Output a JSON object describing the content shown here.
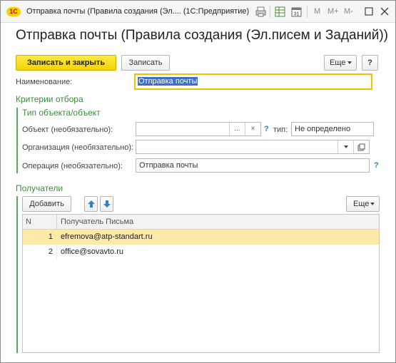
{
  "window": {
    "app_logo": "1С",
    "title": "Отправка почты (Правила создания (Эл.... (1С:Предприятие)",
    "toolbar_m": "M",
    "toolbar_m_plus": "M+",
    "toolbar_m_minus": "M-"
  },
  "page": {
    "title": "Отправка почты (Правила создания (Эл.писем и Заданий))"
  },
  "toolbar": {
    "save_close_label": "Записать и закрыть",
    "save_label": "Записать",
    "more_label": "Еще",
    "help_label": "?"
  },
  "form": {
    "name_label": "Наименование:",
    "name_value": "Отправка почты",
    "criteria_title": "Критерии отбора",
    "object_type_title": "Тип объекта/объект",
    "object_label": "Объект (необязательно):",
    "object_value": "",
    "object_select_label": "...",
    "object_clear_label": "×",
    "help_mark": "?",
    "type_label": "тип:",
    "type_value": "Не определено",
    "org_label": "Организация (необязательно):",
    "org_value": "",
    "operation_label": "Операция (необязательно):",
    "operation_value": "Отправка почты"
  },
  "recipients": {
    "title": "Получатели",
    "add_label": "Добавить",
    "more_label": "Еще",
    "columns": [
      "N",
      "Получатель Письма"
    ],
    "rows": [
      {
        "n": "1",
        "email": "efremova@atp-standart.ru",
        "selected": true
      },
      {
        "n": "2",
        "email": "office@sovavto.ru",
        "selected": false
      }
    ]
  },
  "colors": {
    "primary_button": "#f4d400",
    "group_title": "#3d8b3d",
    "selected_row": "#fdeaa8",
    "focus_border": "#f1c200",
    "help": "#2a7fd4"
  }
}
